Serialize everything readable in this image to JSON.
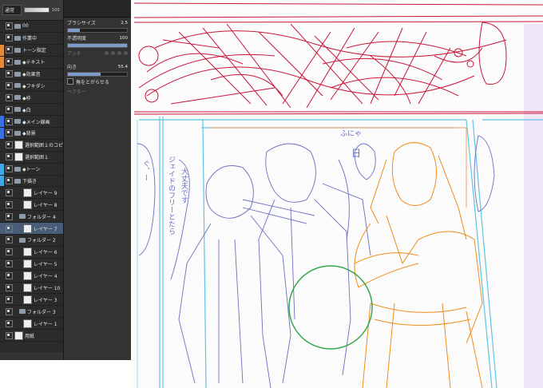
{
  "layer_panel": {
    "blend_mode": "通常",
    "opacity": "100",
    "layers": [
      {
        "name": "00",
        "type": "folder",
        "tag": ""
      },
      {
        "name": "作業中",
        "type": "folder",
        "tag": ""
      },
      {
        "name": "トーン指定",
        "type": "folder",
        "tag": "#e58a3a"
      },
      {
        "name": "◆テキスト",
        "type": "folder",
        "tag": "#e58a3a"
      },
      {
        "name": "◆効果音",
        "type": "folder",
        "tag": ""
      },
      {
        "name": "◆フキダシ",
        "type": "folder",
        "tag": ""
      },
      {
        "name": "◆枠",
        "type": "folder",
        "tag": ""
      },
      {
        "name": "◆白",
        "type": "folder",
        "tag": ""
      },
      {
        "name": "◆メイン線画",
        "type": "folder",
        "tag": "#3b6fe0"
      },
      {
        "name": "◆背景",
        "type": "folder",
        "tag": "#3b6fe0"
      },
      {
        "name": "選択範囲１のコピー",
        "type": "layer",
        "tag": ""
      },
      {
        "name": "選択範囲１",
        "type": "layer",
        "tag": ""
      },
      {
        "name": "◆トーン",
        "type": "folder",
        "tag": "#3fa7e6"
      },
      {
        "name": "下描き",
        "type": "folder",
        "tag": "#3fa7e6"
      },
      {
        "name": "レイヤー 9",
        "type": "layer",
        "tag": ""
      },
      {
        "name": "レイヤー 8",
        "type": "layer",
        "tag": ""
      },
      {
        "name": "フォルダー 4",
        "type": "folder",
        "tag": ""
      },
      {
        "name": "レイヤー 7",
        "type": "layer",
        "tag": "",
        "selected": true
      },
      {
        "name": "フォルダー 2",
        "type": "folder",
        "tag": ""
      },
      {
        "name": "レイヤー 6",
        "type": "layer",
        "tag": ""
      },
      {
        "name": "レイヤー 5",
        "type": "layer",
        "tag": ""
      },
      {
        "name": "レイヤー 4",
        "type": "layer",
        "tag": ""
      },
      {
        "name": "レイヤー 10",
        "type": "layer",
        "tag": ""
      },
      {
        "name": "レイヤー 3",
        "type": "layer",
        "tag": ""
      },
      {
        "name": "フォルダー 3",
        "type": "folder",
        "tag": ""
      },
      {
        "name": "レイヤー 1",
        "type": "layer",
        "tag": ""
      },
      {
        "name": "用紙",
        "type": "paper",
        "tag": ""
      }
    ]
  },
  "tool_panel": {
    "brush_size_label": "ブラシサイズ",
    "brush_size_value": "2.5",
    "opacity_label": "不透明度",
    "opacity_value": "100",
    "antialias_label": "アンチ",
    "direction_label": "向き",
    "direction_value": "55.4",
    "corner_label": "角をとがらせる",
    "vector_label": "ベクター"
  },
  "colors": {
    "panel_bg": "#2b2b2b",
    "selected": "#4a5d78",
    "sketch_red": "#c8163a",
    "sketch_blue": "#6a6fc0",
    "sketch_orange": "#f08c1c",
    "sketch_cyan": "#5ec3e6",
    "sketch_green": "#32a84a"
  },
  "canvas_text": {
    "speech_1": "ふにゃ",
    "speech_2": "大丈夫です",
    "speech_3": "ジェイドのフリーとたら",
    "speech_4": "ぐ、ー",
    "bubble": "日"
  }
}
